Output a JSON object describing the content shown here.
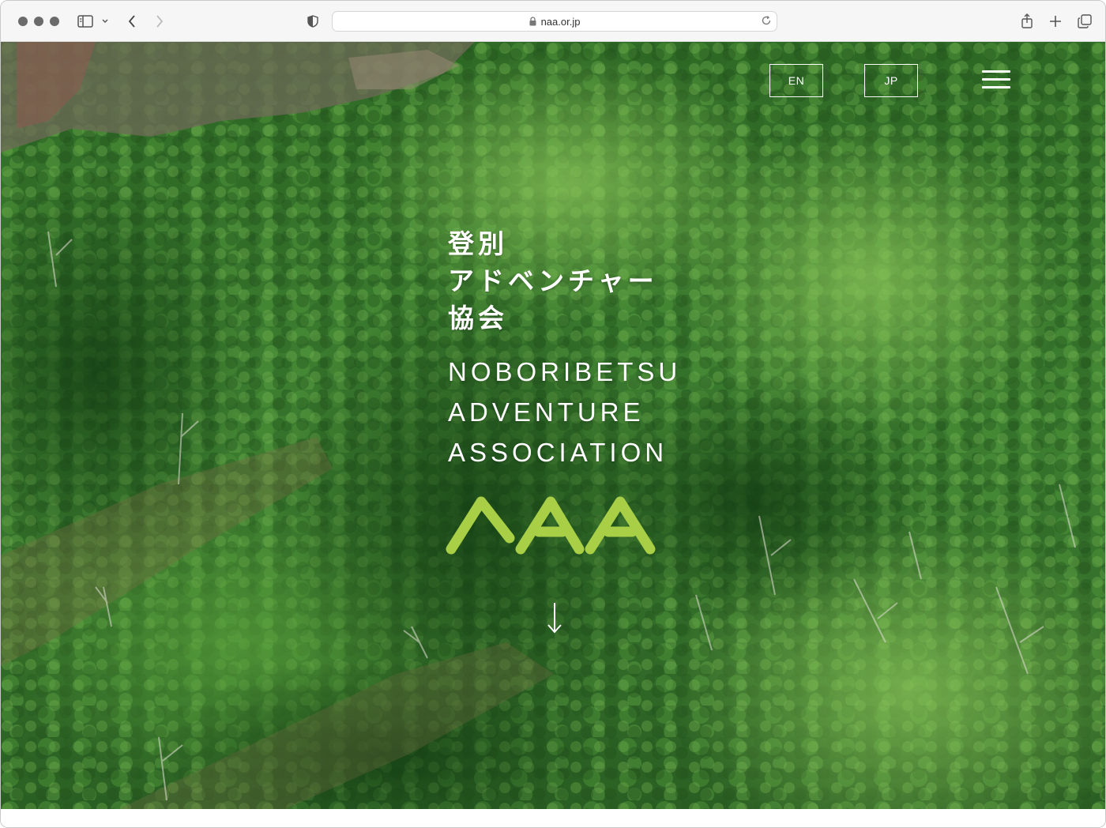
{
  "browser": {
    "url": "naa.or.jp",
    "icons": [
      "sidebar-icon",
      "chevron-down-icon",
      "back-icon",
      "forward-icon",
      "shield-icon",
      "lock-icon",
      "reload-icon",
      "share-icon",
      "new-tab-icon",
      "tabs-overview-icon"
    ]
  },
  "header": {
    "lang_en": "EN",
    "lang_jp": "JP",
    "menu_icon": "hamburger-menu-icon"
  },
  "hero": {
    "title_jp": [
      "登別",
      "アドベンチャー",
      "協会"
    ],
    "title_en": [
      "NOBORIBETSU",
      "ADVENTURE",
      "ASSOCIATION"
    ],
    "logo_text": "NAA",
    "scroll_icon": "arrow-down-icon"
  },
  "colors": {
    "logo_green": "#a8cf45",
    "forest_dark": "#1f4f1c",
    "forest_mid": "#3f8a32",
    "forest_light": "#7fbd4e",
    "white": "#ffffff"
  }
}
